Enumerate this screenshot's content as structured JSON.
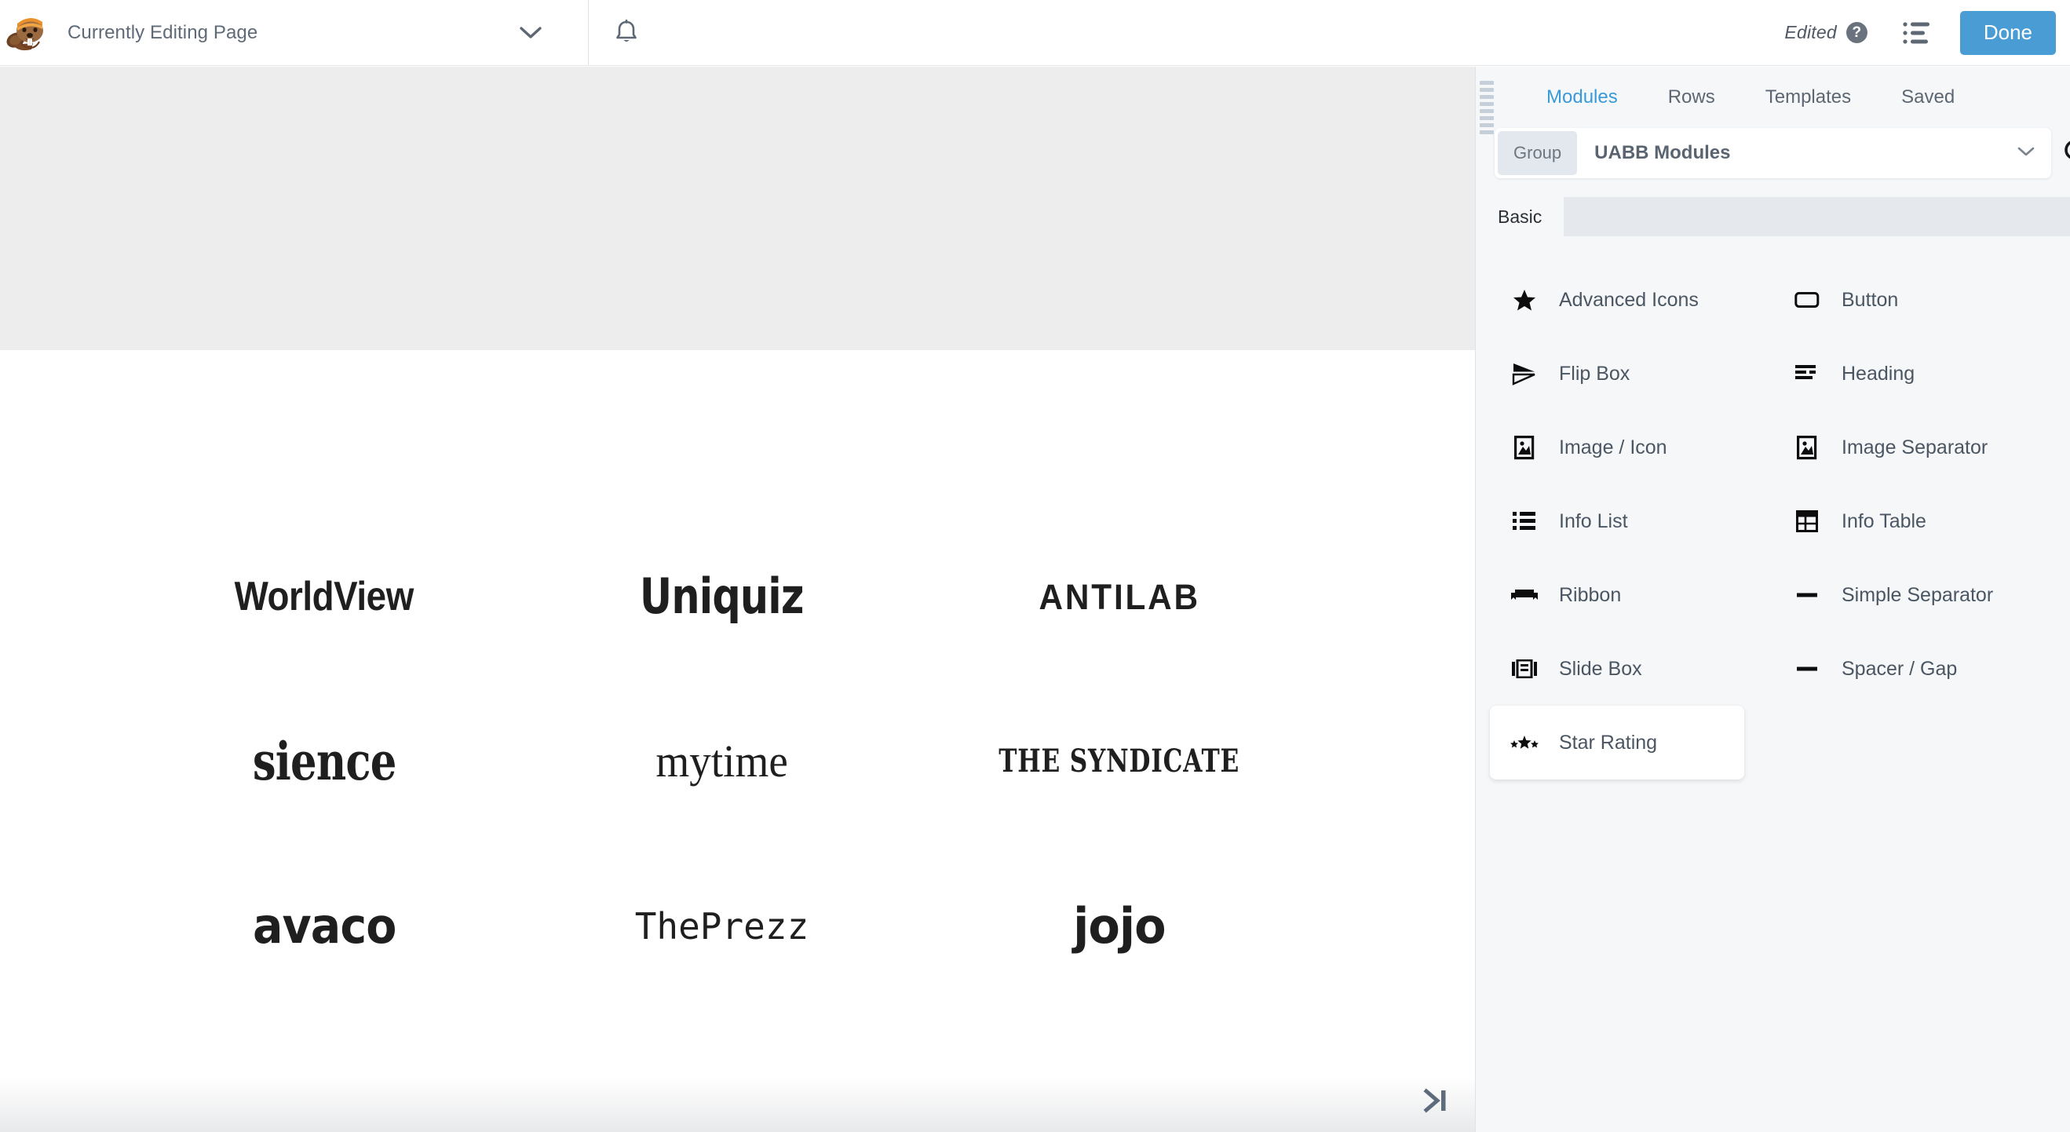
{
  "topbar": {
    "logo_icon": "beaver-builder-logo",
    "title": "Currently Editing Page",
    "chevron_icon": "chevron-down-icon",
    "bell_icon": "bell-icon",
    "edited_label": "Edited",
    "help_icon": "help-question-icon",
    "help_glyph": "?",
    "outline_icon": "outline-list-icon",
    "done_label": "Done",
    "done_color": "#4a9cd4"
  },
  "canvas": {
    "logos": [
      {
        "name": "WorldView",
        "style": "worldview"
      },
      {
        "name": "Uniquiz",
        "style": "uniquiz"
      },
      {
        "name": "ANTILAB",
        "style": "antilab"
      },
      {
        "name": "sience",
        "style": "sience"
      },
      {
        "name": "mytime",
        "style": "mytime"
      },
      {
        "name": "THE SYNDICATE",
        "style": "syndicate"
      },
      {
        "name": "avaco",
        "style": "avaco"
      },
      {
        "name": "ThePrezz",
        "style": "theprezz"
      },
      {
        "name": "jojo",
        "style": "jojo"
      }
    ],
    "skip_icon": "skip-to-end-icon",
    "band_color": "#ededed"
  },
  "panel": {
    "grip_icon": "drag-grip-icon",
    "tabs": [
      {
        "label": "Modules",
        "active": true
      },
      {
        "label": "Rows",
        "active": false
      },
      {
        "label": "Templates",
        "active": false
      },
      {
        "label": "Saved",
        "active": false
      }
    ],
    "active_tab_color": "#3a9ad9",
    "search": {
      "group_label": "Group",
      "selected_group": "UABB Modules",
      "chevron_icon": "chevron-down-icon",
      "search_icon": "search-icon"
    },
    "subtabs": [
      {
        "label": "Basic",
        "active": true
      }
    ],
    "modules": [
      {
        "label": "Advanced Icons",
        "icon": "star-icon",
        "hovered": false
      },
      {
        "label": "Button",
        "icon": "button-rect-icon",
        "hovered": false
      },
      {
        "label": "Flip Box",
        "icon": "flip-box-icon",
        "hovered": false
      },
      {
        "label": "Heading",
        "icon": "heading-lines-icon",
        "hovered": false
      },
      {
        "label": "Image / Icon",
        "icon": "image-icon",
        "hovered": false
      },
      {
        "label": "Image Separator",
        "icon": "image-icon",
        "hovered": false
      },
      {
        "label": "Info List",
        "icon": "bulleted-list-icon",
        "hovered": false
      },
      {
        "label": "Info Table",
        "icon": "table-grid-icon",
        "hovered": false
      },
      {
        "label": "Ribbon",
        "icon": "ribbon-icon",
        "hovered": false
      },
      {
        "label": "Simple Separator",
        "icon": "horizontal-rule-icon",
        "hovered": false
      },
      {
        "label": "Slide Box",
        "icon": "carousel-icon",
        "hovered": false
      },
      {
        "label": "Spacer / Gap",
        "icon": "horizontal-rule-icon",
        "hovered": false
      },
      {
        "label": "Star Rating",
        "icon": "star-rating-icon",
        "hovered": true
      }
    ]
  }
}
